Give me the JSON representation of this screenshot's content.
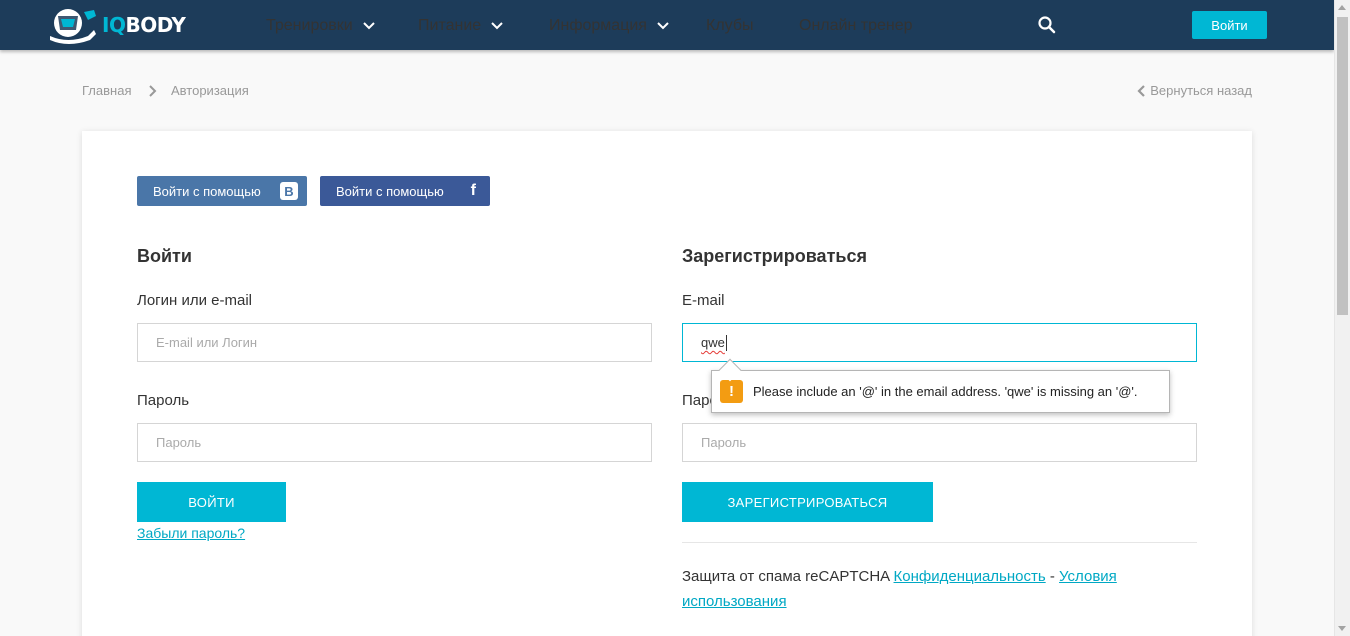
{
  "header": {
    "logo_prefix": "IQ",
    "logo_suffix": "BODY",
    "nav": [
      {
        "label": "Тренировки",
        "dropdown": true
      },
      {
        "label": "Питание",
        "dropdown": true
      },
      {
        "label": "Информация",
        "dropdown": true
      },
      {
        "label": "Клубы",
        "dropdown": false
      },
      {
        "label": "Онлайн тренер",
        "dropdown": false
      }
    ],
    "search_icon": "search-icon",
    "login_label": "Войти",
    "colors": {
      "bg": "#1d3c5a",
      "accent": "#00b7d4"
    }
  },
  "breadcrumb": {
    "home": "Главная",
    "current": "Авторизация",
    "back": "Вернуться назад"
  },
  "social": {
    "vk_label": "Войти с помощью",
    "vk_icon": "В",
    "fb_label": "Войти с помощью",
    "fb_icon": "f"
  },
  "login": {
    "title": "Войти",
    "login_label": "Логин или e-mail",
    "login_placeholder": "E-mail или Логин",
    "password_label": "Пароль",
    "password_placeholder": "Пароль",
    "submit": "ВОЙТИ",
    "forgot": "Забыли пароль?"
  },
  "register": {
    "title": "Зарегистрироваться",
    "email_label": "E-mail",
    "email_value": "qwe",
    "password_label": "Пароль",
    "password_placeholder": "Пароль",
    "submit": "ЗАРЕГИСТРИРОВАТЬСЯ"
  },
  "validation": {
    "icon": "!",
    "message": "Please include an '@' in the email address. 'qwe' is missing an '@'."
  },
  "recaptcha": {
    "text": "Защита от спама reCAPTCHA",
    "privacy": "Конфиденциальность",
    "separator": "-",
    "terms": "Условия использования"
  }
}
